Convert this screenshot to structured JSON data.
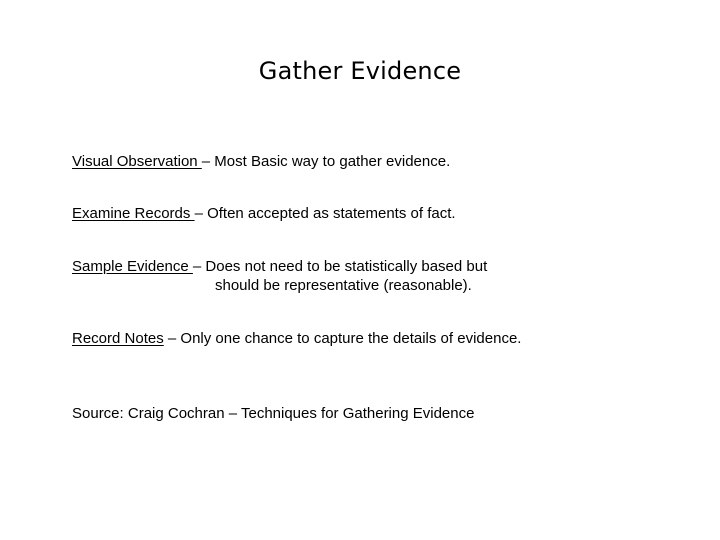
{
  "slide": {
    "title": "Gather Evidence",
    "background_color": "#ffffff",
    "text_color": "#000000",
    "paragraphs": [
      {
        "id": "visual-observation",
        "term": "Visual Observation ",
        "rest": "– Most Basic way to gather evidence."
      },
      {
        "id": "examine-records",
        "term": "Examine Records ",
        "rest": "– Often accepted as statements of fact."
      },
      {
        "id": "sample-evidence",
        "term": "Sample Evidence ",
        "rest": "– Does not need to be statistically based but",
        "continuation": "should be representative (reasonable)."
      },
      {
        "id": "record-notes",
        "term": "Record Notes",
        "rest": " – Only one chance to capture the details of evidence."
      }
    ],
    "source": "Source: Craig Cochran – Techniques for Gathering Evidence"
  }
}
